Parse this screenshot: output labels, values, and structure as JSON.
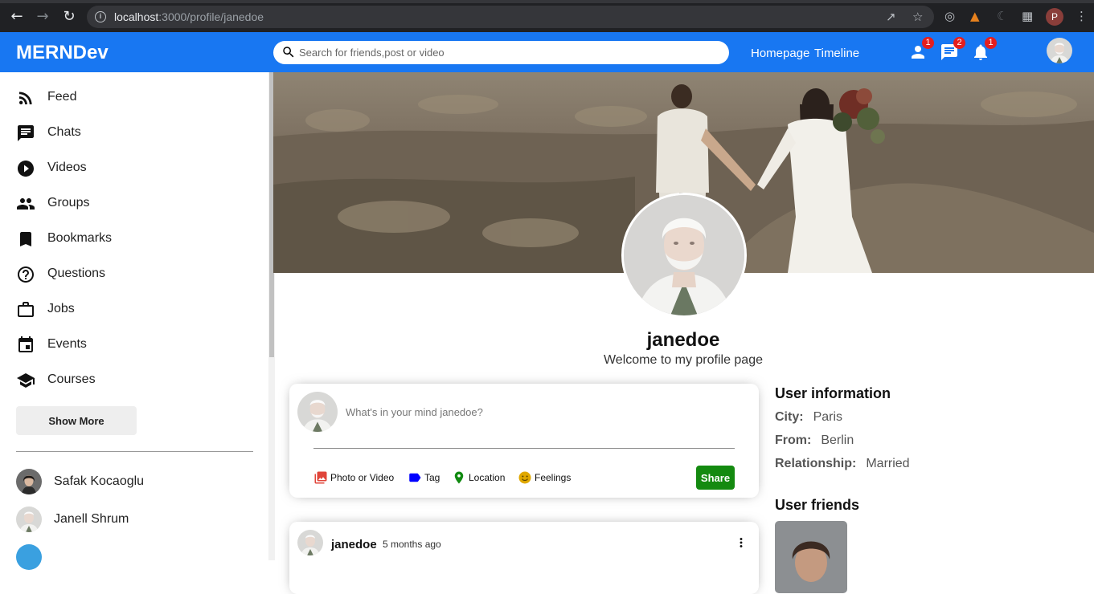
{
  "browser": {
    "url_host": "localhost",
    "url_rest": ":3000/profile/janedoe",
    "profile_initial": "P"
  },
  "app": {
    "logo": "MERNDev"
  },
  "search": {
    "placeholder": "Search for friends,post or video"
  },
  "nav": {
    "homepage": "Homepage",
    "timeline": "Timeline"
  },
  "notifications": {
    "friends": "1",
    "messages": "2",
    "alerts": "1"
  },
  "sidebar": {
    "items": [
      {
        "label": "Feed",
        "icon": "rss-feed-icon"
      },
      {
        "label": "Chats",
        "icon": "chat-icon"
      },
      {
        "label": "Videos",
        "icon": "play-circle-icon"
      },
      {
        "label": "Groups",
        "icon": "group-icon"
      },
      {
        "label": "Bookmarks",
        "icon": "bookmark-icon"
      },
      {
        "label": "Questions",
        "icon": "help-outline-icon"
      },
      {
        "label": "Jobs",
        "icon": "work-outline-icon"
      },
      {
        "label": "Events",
        "icon": "event-icon"
      },
      {
        "label": "Courses",
        "icon": "school-icon"
      }
    ],
    "show_more": "Show More",
    "friends": [
      {
        "name": "Safak Kocaoglu"
      },
      {
        "name": "Janell Shrum"
      }
    ]
  },
  "profile": {
    "username": "janedoe",
    "description": "Welcome to my profile page"
  },
  "share": {
    "placeholder": "What's in your mind janedoe?",
    "options": [
      {
        "label": "Photo or Video",
        "color": "#e0453a"
      },
      {
        "label": "Tag",
        "color": "#0000ff"
      },
      {
        "label": "Location",
        "color": "#118a11"
      },
      {
        "label": "Feelings",
        "color": "#e0a800"
      }
    ],
    "button": "Share",
    "button_color": "#148a10"
  },
  "post": {
    "username": "janedoe",
    "date": "5 months ago"
  },
  "user_info": {
    "title": "User information",
    "city_label": "City:",
    "city": "Paris",
    "from_label": "From:",
    "from": "Berlin",
    "relationship_label": "Relationship:",
    "relationship": "Married"
  },
  "user_friends": {
    "title": "User friends"
  },
  "colors": {
    "brand": "#1877f2",
    "badge": "#e41e1e"
  }
}
